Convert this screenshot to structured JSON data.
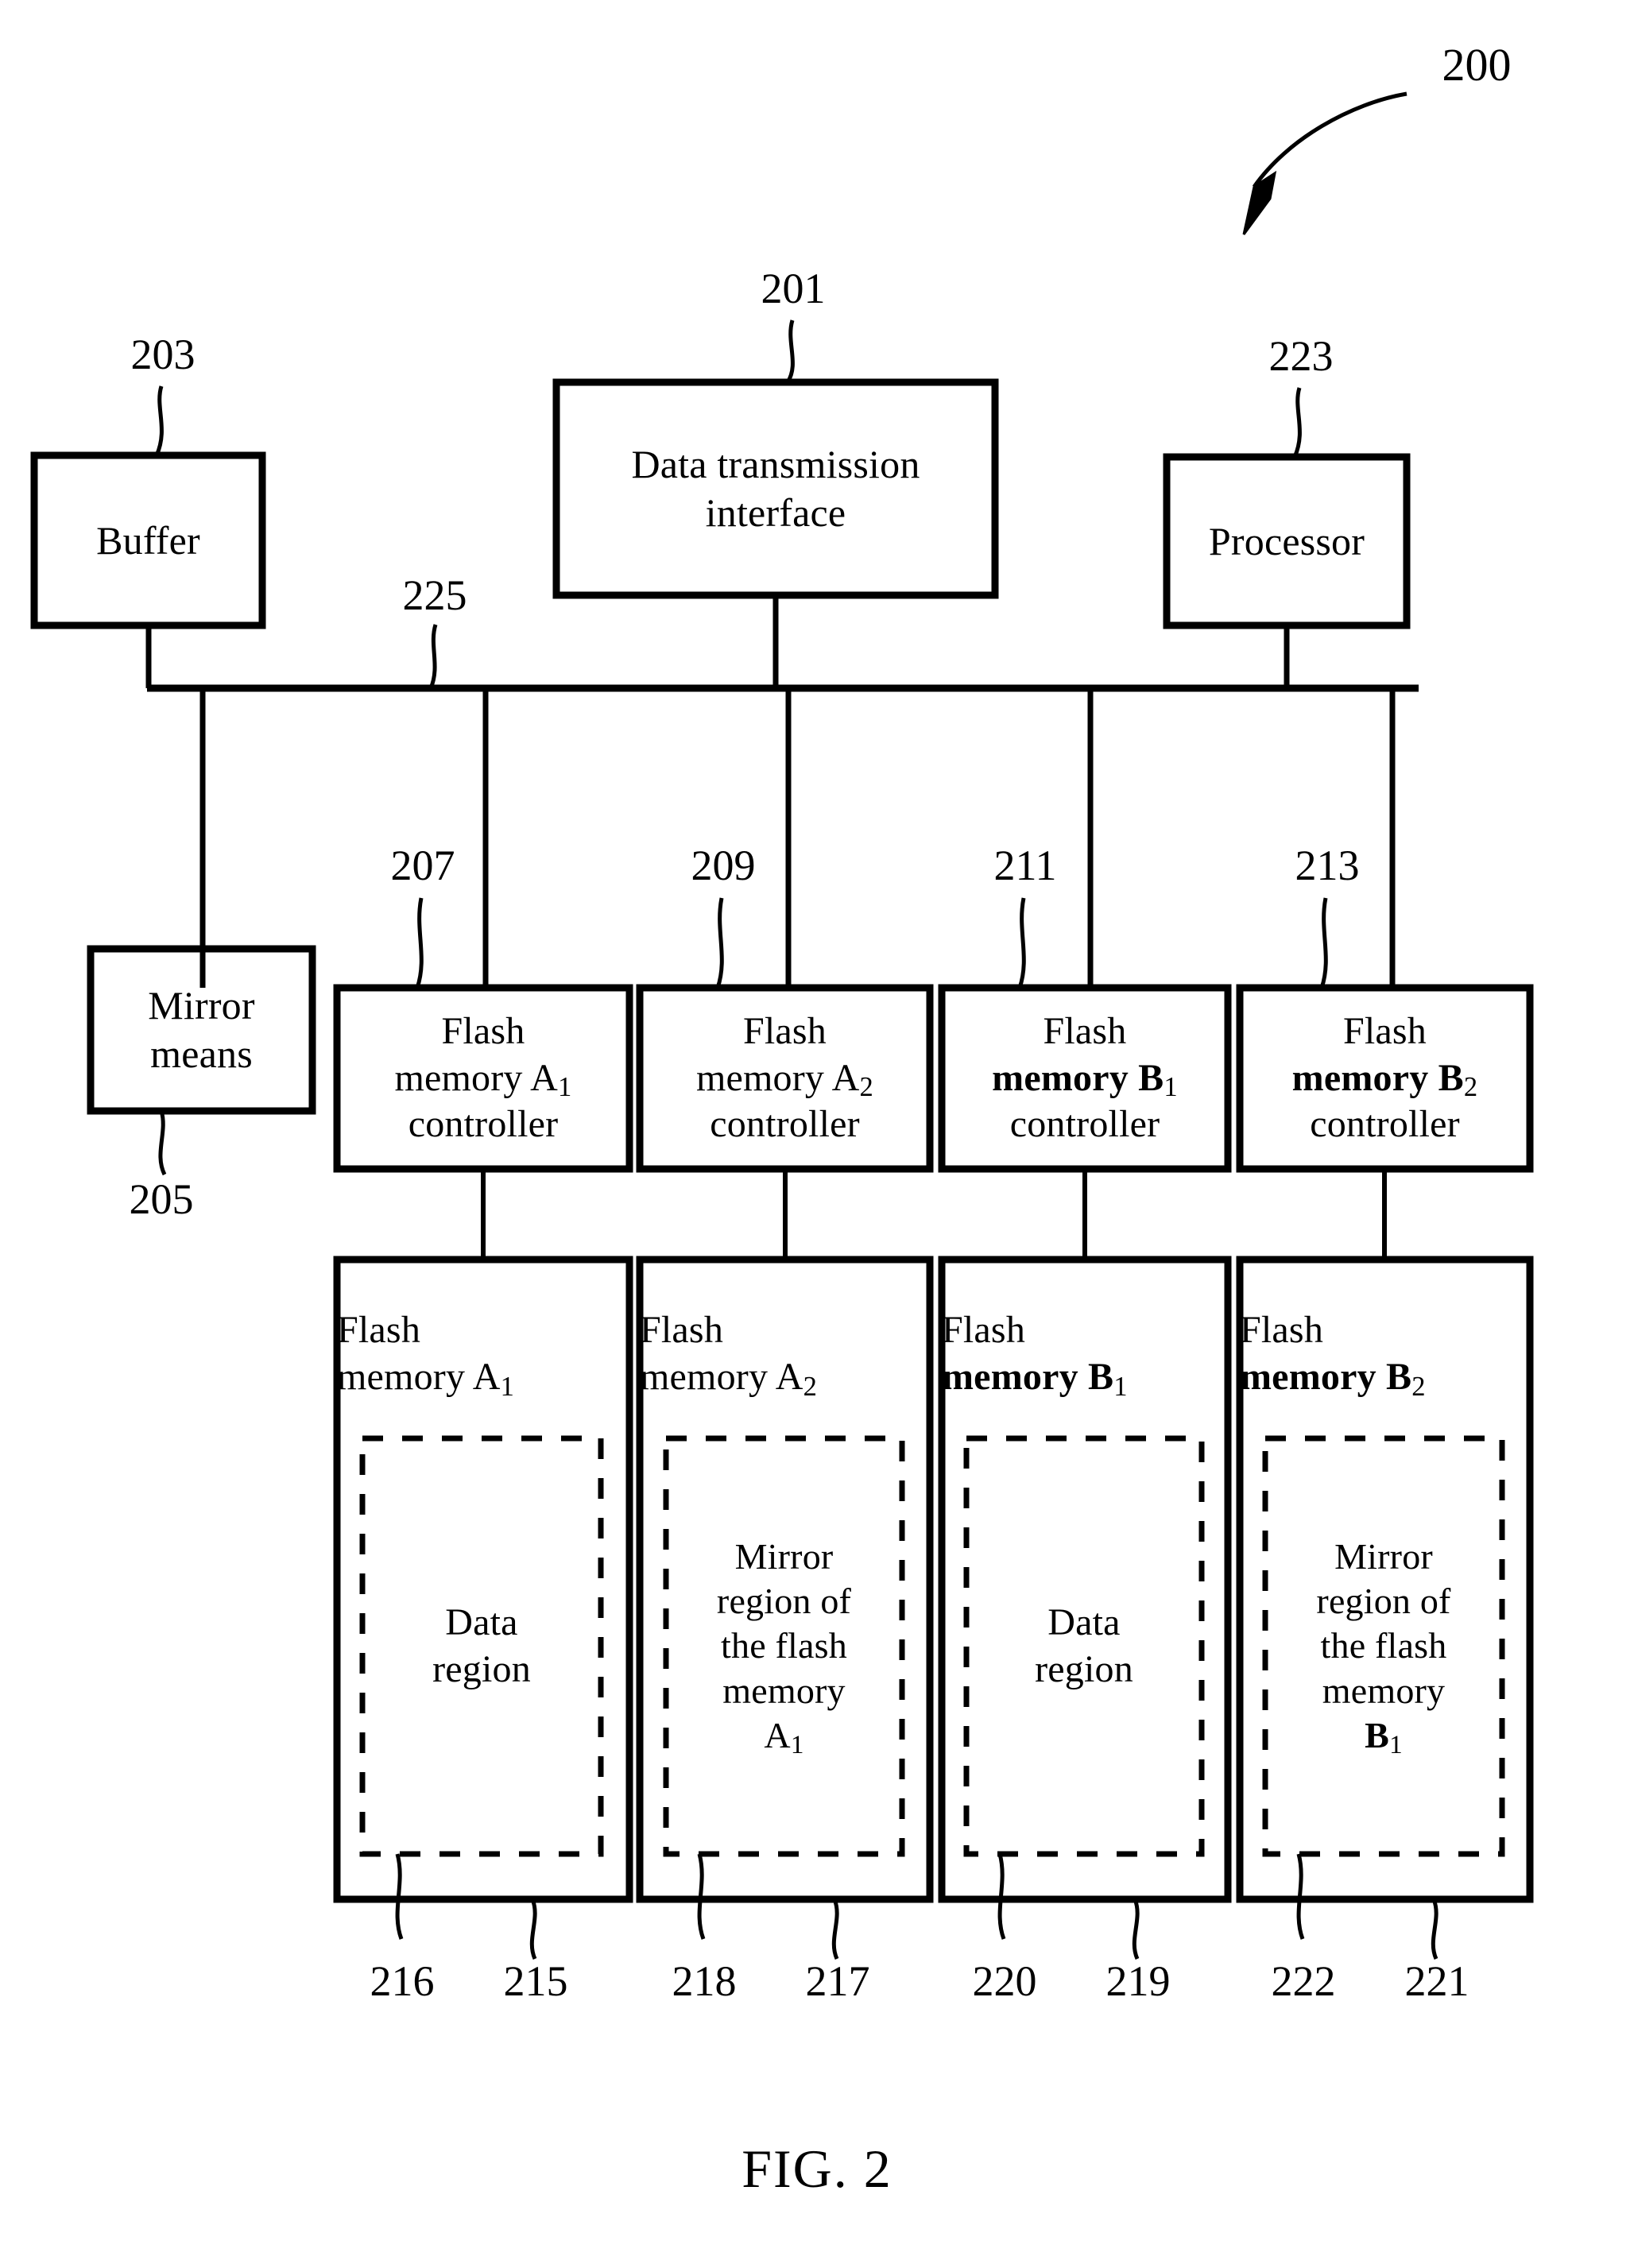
{
  "figure": {
    "caption": "FIG. 2",
    "system_ref": "200"
  },
  "blocks": {
    "buffer": {
      "label": "Buffer",
      "ref": "203"
    },
    "data_transmission_interface": {
      "line1": "Data transmission",
      "line2": "interface",
      "ref": "201"
    },
    "processor": {
      "label": "Processor",
      "ref": "223"
    },
    "mirror_means": {
      "line1": "Mirror",
      "line2": "means",
      "ref": "205"
    },
    "bus": {
      "ref": "225"
    }
  },
  "controllers": [
    {
      "line1": "Flash",
      "line2": "memory A",
      "sub": "1",
      "line3": "controller",
      "ref": "207"
    },
    {
      "line1": "Flash",
      "line2": "memory A",
      "sub": "2",
      "line3": "controller",
      "ref": "209"
    },
    {
      "line1": "Flash",
      "line2": "memory B",
      "sub": "1",
      "line3": "controller",
      "ref": "211"
    },
    {
      "line1": "Flash",
      "line2": "memory B",
      "sub": "2",
      "line3": "controller",
      "ref": "213"
    }
  ],
  "memories": [
    {
      "line1": "Flash",
      "line2": "memory A",
      "sub": "1",
      "region_lines": [
        "Data",
        "region"
      ],
      "region_sub": "",
      "ref_region": "216",
      "ref_memory": "215"
    },
    {
      "line1": "Flash",
      "line2": "memory A",
      "sub": "2",
      "region_lines": [
        "Mirror",
        "region of",
        "the flash",
        "memory",
        "A"
      ],
      "region_sub": "1",
      "ref_region": "218",
      "ref_memory": "217"
    },
    {
      "line1": "Flash",
      "line2": "memory B",
      "sub": "1",
      "region_lines": [
        "Data",
        "region"
      ],
      "region_sub": "",
      "ref_region": "220",
      "ref_memory": "219"
    },
    {
      "line1": "Flash",
      "line2": "memory B",
      "sub": "2",
      "region_lines": [
        "Mirror",
        "region of",
        "the flash",
        "memory",
        "B"
      ],
      "region_sub": "1",
      "ref_region": "222",
      "ref_memory": "221"
    }
  ],
  "colors": {
    "stroke": "#000000",
    "background": "#ffffff"
  }
}
